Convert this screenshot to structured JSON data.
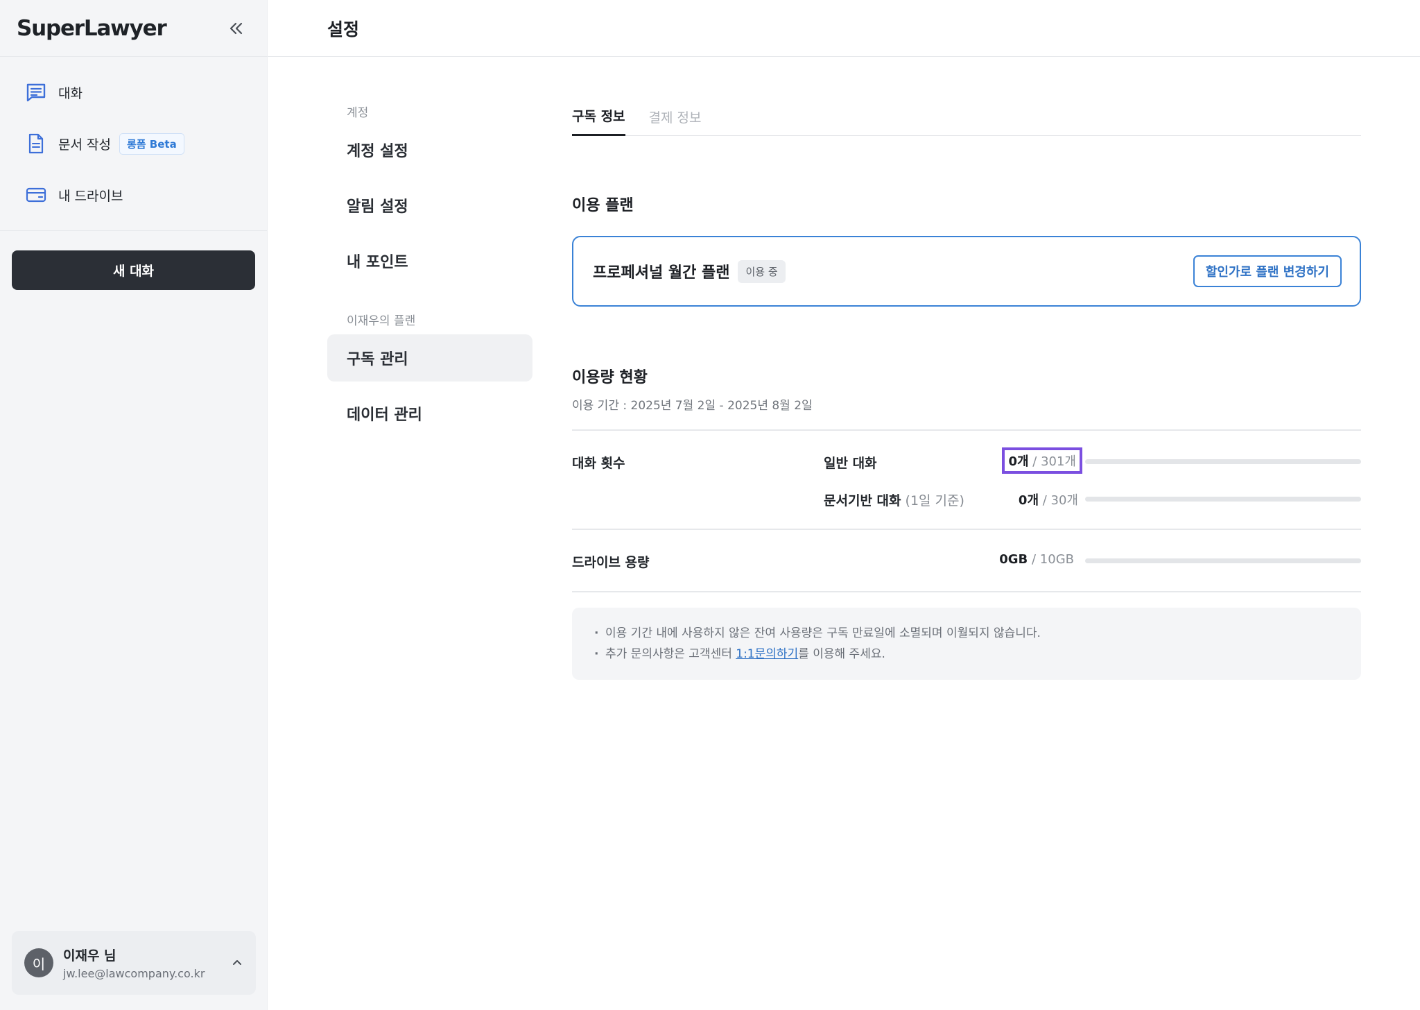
{
  "sidebar": {
    "logo": "SuperLawyer",
    "nav": [
      {
        "label": "대화",
        "icon": "chat-icon"
      },
      {
        "label": "문서 작성",
        "icon": "document-icon",
        "badge": "롱폼 Beta"
      },
      {
        "label": "내 드라이브",
        "icon": "drive-icon"
      }
    ],
    "new_chat_label": "새 대화",
    "user": {
      "initial": "이",
      "name": "이재우 님",
      "email": "jw.lee@lawcompany.co.kr"
    }
  },
  "header": {
    "title": "설정"
  },
  "settings_menu": {
    "account_section": "계정",
    "account_items": [
      "계정 설정",
      "알림 설정",
      "내 포인트"
    ],
    "plan_section": "이재우의 플랜",
    "plan_items": [
      "구독 관리",
      "데이터 관리"
    ],
    "active": "구독 관리"
  },
  "tabs": [
    {
      "label": "구독 정보",
      "active": true
    },
    {
      "label": "결제 정보",
      "active": false
    }
  ],
  "plan": {
    "section_title": "이용 플랜",
    "name": "프로페셔널 월간 플랜",
    "status": "이용 중",
    "change_button": "할인가로 플랜 변경하기"
  },
  "usage": {
    "section_title": "이용량 현황",
    "period": "이용 기간 : 2025년 7월 2일 - 2025년 8월 2일",
    "chat_label": "대화 횟수",
    "general": {
      "label": "일반 대화",
      "current": "0개",
      "limit": " / 301개",
      "fraction": 0
    },
    "document": {
      "label": "문서기반 대화",
      "note": " (1일 기준)",
      "current": "0개",
      "limit": " / 30개",
      "fraction": 0
    },
    "drive": {
      "label": "드라이브 용량",
      "current": "0GB",
      "limit": " / 10GB",
      "fraction": 0
    }
  },
  "notice": {
    "line1": "이용 기간 내에 사용하지 않은 잔여 사용량은 구독 만료일에 소멸되며 이월되지 않습니다.",
    "line2_prefix": "추가 문의사항은 고객센터 ",
    "line2_link": "1:1문의하기",
    "line2_suffix": "를 이용해 주세요."
  },
  "colors": {
    "accent": "#3a82d6",
    "highlight_border": "#7b4fe0",
    "new_chat_bg": "#2b2f36"
  }
}
